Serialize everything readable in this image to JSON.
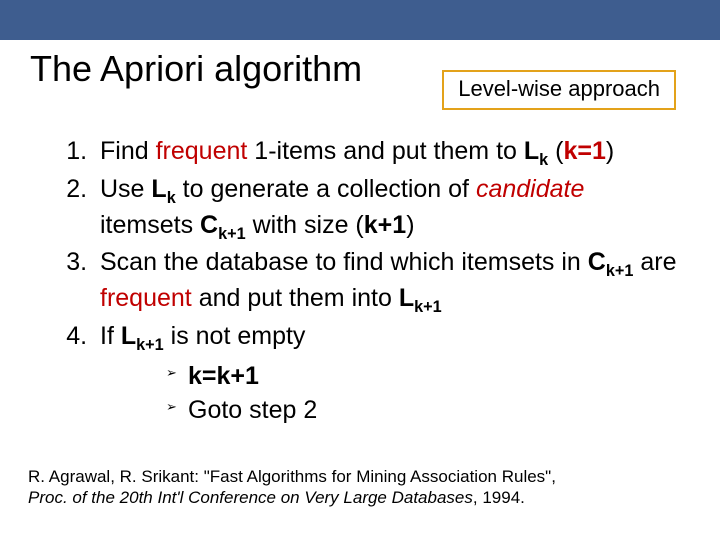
{
  "title": "The Apriori algorithm",
  "badge": "Level-wise approach",
  "steps": {
    "s1": {
      "pre": "Find ",
      "red1": "frequent",
      "mid1": " 1-items and put them to ",
      "lk": "L",
      "lksub": "k",
      "paren": " (",
      "red2": "k=1",
      "close": ")"
    },
    "s2": {
      "pre": "Use ",
      "lk": "L",
      "lksub": "k",
      "mid": " to generate a collection of ",
      "cand": "candidate",
      "mid2": " itemsets ",
      "ck": "C",
      "cksub": "k+1",
      "tail": " with size (",
      "kp1": "k+1",
      "close2": ")"
    },
    "s3": {
      "pre": "Scan the database to find which itemsets in ",
      "ck": "C",
      "cksub": "k+1",
      "mid": " are ",
      "freq": "frequent",
      "mid2": " and put them into ",
      "lk": "L",
      "lksub": "k+1"
    },
    "s4": {
      "pre": "If ",
      "lk": "L",
      "lksub": "k+1",
      "tail": " is not empty"
    },
    "sub1": "k=k+1",
    "sub2": "Goto step 2"
  },
  "citation": {
    "line1": "R. Agrawal, R. Srikant: \"Fast Algorithms for Mining Association Rules\", ",
    "line2": "Proc. of the 20th Int'l Conference on Very Large Databases",
    "year": ", 1994."
  }
}
